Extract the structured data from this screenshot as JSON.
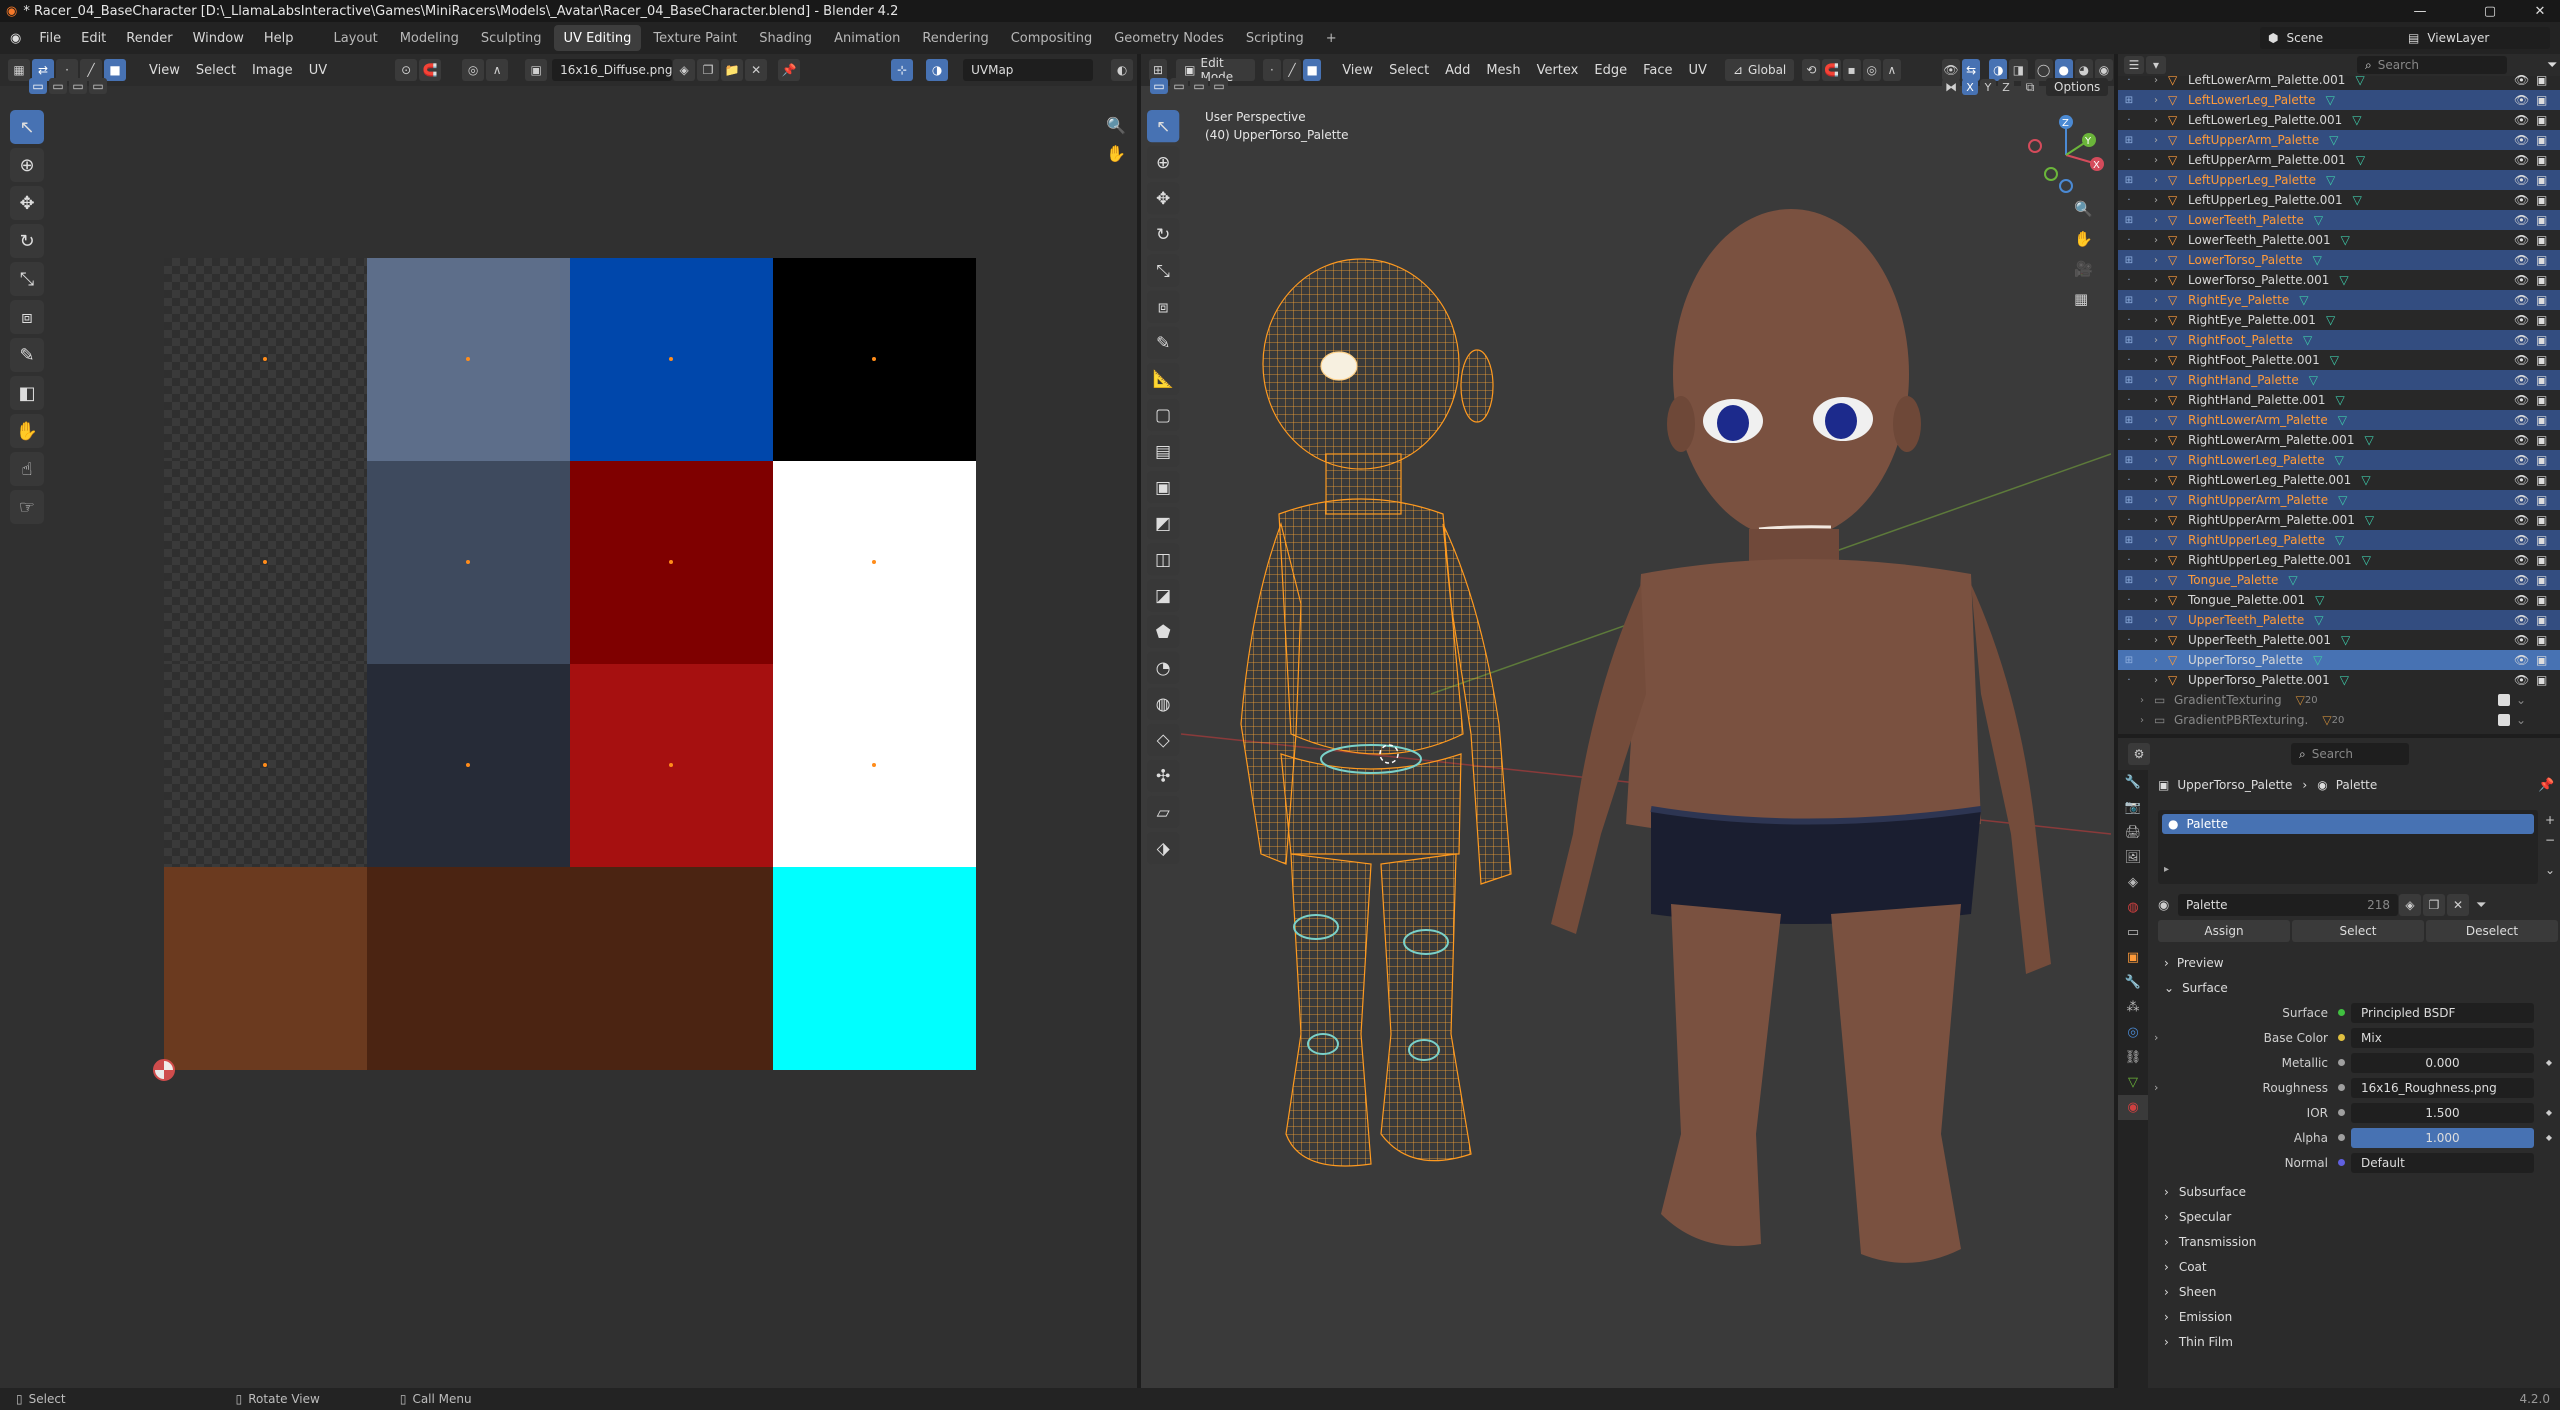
{
  "window": {
    "title": "* Racer_04_BaseCharacter [D:\\_LlamaLabsInteractive\\Games\\MiniRacers\\Models\\_Avatar\\Racer_04_BaseCharacter.blend] - Blender 4.2"
  },
  "menubar": {
    "items": [
      "File",
      "Edit",
      "Render",
      "Window",
      "Help"
    ],
    "workspaces": [
      "Layout",
      "Modeling",
      "Sculpting",
      "UV Editing",
      "Texture Paint",
      "Shading",
      "Animation",
      "Rendering",
      "Compositing",
      "Geometry Nodes",
      "Scripting"
    ],
    "active_workspace": "UV Editing",
    "scene": "Scene",
    "viewlayer": "ViewLayer"
  },
  "uv_editor": {
    "menus": [
      "View",
      "Select",
      "Image",
      "UV"
    ],
    "image_name": "16x16_Diffuse.png",
    "uvmap": "UVMap",
    "palette": [
      [
        "#transparent",
        "#5d6e8a",
        "#0047ab",
        "#000000"
      ],
      [
        "#transparent",
        "#3e4a5e",
        "#7f0000",
        "#ffffff"
      ],
      [
        "#transparent",
        "#262b37",
        "#a61010",
        "#ffffff"
      ],
      [
        "#6b3a1f",
        "#4b2412",
        "#4b2412",
        "#00ffff"
      ]
    ]
  },
  "viewport": {
    "mode": "Edit Mode",
    "menus": [
      "View",
      "Select",
      "Add",
      "Mesh",
      "Vertex",
      "Edge",
      "Face",
      "UV"
    ],
    "orientation": "Global",
    "options": "Options",
    "perspective": "User Perspective",
    "object_label": "(40) UpperTorso_Palette",
    "axes": [
      "X",
      "Y",
      "Z"
    ]
  },
  "outliner": {
    "search_placeholder": "Search",
    "rows": [
      {
        "name": "LeftLowerArm_Palette.001",
        "sel": false
      },
      {
        "name": "LeftLowerLeg_Palette",
        "sel": true
      },
      {
        "name": "LeftLowerLeg_Palette.001",
        "sel": false
      },
      {
        "name": "LeftUpperArm_Palette",
        "sel": true
      },
      {
        "name": "LeftUpperArm_Palette.001",
        "sel": false
      },
      {
        "name": "LeftUpperLeg_Palette",
        "sel": true
      },
      {
        "name": "LeftUpperLeg_Palette.001",
        "sel": false
      },
      {
        "name": "LowerTeeth_Palette",
        "sel": true
      },
      {
        "name": "LowerTeeth_Palette.001",
        "sel": false
      },
      {
        "name": "LowerTorso_Palette",
        "sel": true
      },
      {
        "name": "LowerTorso_Palette.001",
        "sel": false
      },
      {
        "name": "RightEye_Palette",
        "sel": true
      },
      {
        "name": "RightEye_Palette.001",
        "sel": false
      },
      {
        "name": "RightFoot_Palette",
        "sel": true
      },
      {
        "name": "RightFoot_Palette.001",
        "sel": false
      },
      {
        "name": "RightHand_Palette",
        "sel": true
      },
      {
        "name": "RightHand_Palette.001",
        "sel": false
      },
      {
        "name": "RightLowerArm_Palette",
        "sel": true
      },
      {
        "name": "RightLowerArm_Palette.001",
        "sel": false
      },
      {
        "name": "RightLowerLeg_Palette",
        "sel": true
      },
      {
        "name": "RightLowerLeg_Palette.001",
        "sel": false
      },
      {
        "name": "RightUpperArm_Palette",
        "sel": true
      },
      {
        "name": "RightUpperArm_Palette.001",
        "sel": false
      },
      {
        "name": "RightUpperLeg_Palette",
        "sel": true
      },
      {
        "name": "RightUpperLeg_Palette.001",
        "sel": false
      },
      {
        "name": "Tongue_Palette",
        "sel": true
      },
      {
        "name": "Tongue_Palette.001",
        "sel": false
      },
      {
        "name": "UpperTeeth_Palette",
        "sel": true
      },
      {
        "name": "UpperTeeth_Palette.001",
        "sel": false
      },
      {
        "name": "UpperTorso_Palette",
        "sel": true,
        "active": true
      },
      {
        "name": "UpperTorso_Palette.001",
        "sel": false
      }
    ],
    "collections": [
      {
        "name": "GradientTexturing",
        "count": "20"
      },
      {
        "name": "GradientPBRTexturing.",
        "count": "20"
      }
    ]
  },
  "properties": {
    "search_placeholder": "Search",
    "breadcrumb_obj": "UpperTorso_Palette",
    "breadcrumb_mat": "Palette",
    "slot": "Palette",
    "material_name": "Palette",
    "users": "218",
    "buttons": {
      "assign": "Assign",
      "select": "Select",
      "deselect": "Deselect"
    },
    "preview": "Preview",
    "surface_panel": "Surface",
    "fields": [
      {
        "label": "Surface",
        "value": "Principled BSDF",
        "dot": "#40c040"
      },
      {
        "label": "Base Color",
        "value": "Mix",
        "dot": "#e0c040",
        "expand": true
      },
      {
        "label": "Metallic",
        "value": "0.000",
        "dot": "#a0a0a0",
        "num": true
      },
      {
        "label": "Roughness",
        "value": "16x16_Roughness.png",
        "dot": "#a0a0a0",
        "expand": true
      },
      {
        "label": "IOR",
        "value": "1.500",
        "dot": "#a0a0a0",
        "num": true
      },
      {
        "label": "Alpha",
        "value": "1.000",
        "dot": "#a0a0a0",
        "num": true,
        "bar": true
      },
      {
        "label": "Normal",
        "value": "Default",
        "dot": "#6060e0"
      }
    ],
    "subpanels": [
      "Subsurface",
      "Specular",
      "Transmission",
      "Coat",
      "Sheen",
      "Emission",
      "Thin Film"
    ]
  },
  "statusbar": {
    "select": "Select",
    "rotate": "Rotate View",
    "call_menu": "Call Menu",
    "version": "4.2.0"
  }
}
